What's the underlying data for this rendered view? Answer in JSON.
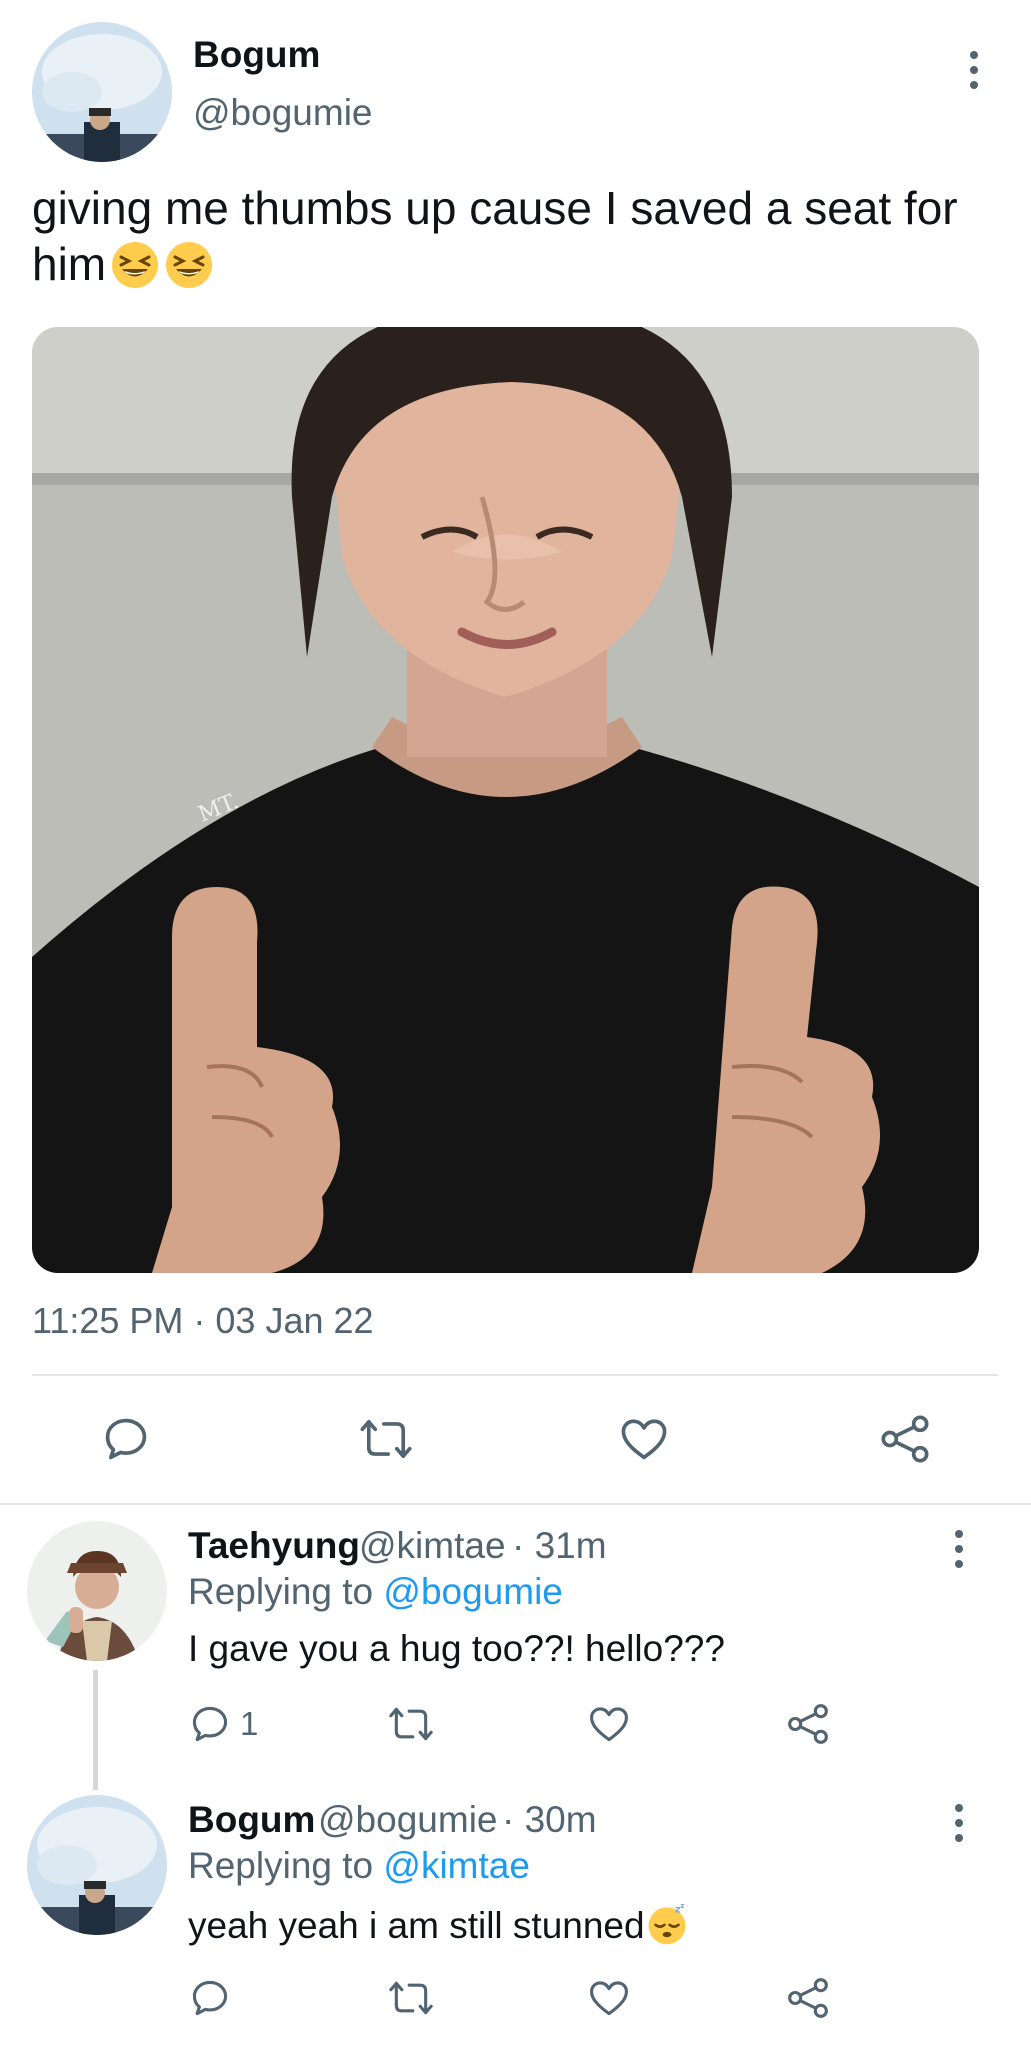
{
  "main_tweet": {
    "author_name": "Bogum",
    "author_handle": "@bogumie",
    "text": "giving me thumbs up cause I saved a seat for him",
    "emoji": [
      "grinning-squinting-face",
      "grinning-squinting-face"
    ],
    "image_watermark": "MT.",
    "timestamp": "11:25 PM · 03 Jan 22",
    "actions": [
      "reply",
      "retweet",
      "like",
      "share"
    ]
  },
  "replies": [
    {
      "author_name": "Taehyung",
      "author_handle": "@kimtae",
      "time": "· 31m",
      "replying_prefix": "Replying to ",
      "replying_to": "@bogumie",
      "text": "I gave you a hug too??! hello???",
      "reply_count": "1"
    },
    {
      "author_name": "Bogum",
      "author_handle": "@bogumie",
      "time": "· 30m",
      "replying_prefix": "Replying to ",
      "replying_to": "@kimtae",
      "text": "yeah yeah i am still stunned",
      "emoji": "sleeping-face",
      "reply_count": ""
    }
  ],
  "colors": {
    "text": "#0f1419",
    "secondary": "#536471",
    "link": "#1d9bf0",
    "divider": "#e3e6e9"
  }
}
